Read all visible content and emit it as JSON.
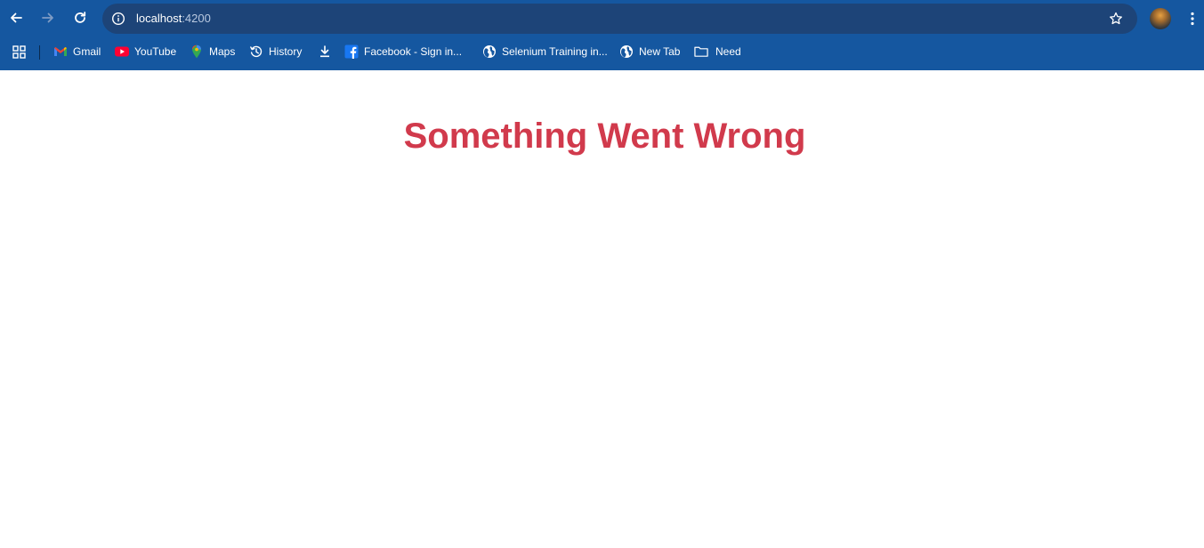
{
  "browser": {
    "url": {
      "host": "localhost",
      "port": ":4200"
    },
    "colors": {
      "chrome": "#1557a0",
      "omnibox": "#1d4478"
    },
    "icons": {
      "back": "arrow-left-icon",
      "forward": "arrow-right-icon",
      "reload": "reload-icon",
      "site_info": "info-icon",
      "bookmark_star": "star-icon",
      "menu": "kebab-menu-icon",
      "apps": "apps-grid-icon"
    }
  },
  "bookmarks": [
    {
      "label": "Gmail",
      "icon": "gmail-icon"
    },
    {
      "label": "YouTube",
      "icon": "youtube-icon"
    },
    {
      "label": "Maps",
      "icon": "maps-icon"
    },
    {
      "label": "History",
      "icon": "history-icon"
    },
    {
      "label": "",
      "icon": "download-icon"
    },
    {
      "label": "Facebook - Sign in...",
      "icon": "facebook-icon"
    },
    {
      "label": "Selenium Training in...",
      "icon": "globe-icon"
    },
    {
      "label": "New Tab",
      "icon": "globe-icon"
    },
    {
      "label": "Need",
      "icon": "folder-icon"
    }
  ],
  "page": {
    "title": "Something Went Wrong",
    "title_color": "#d13a4c"
  }
}
